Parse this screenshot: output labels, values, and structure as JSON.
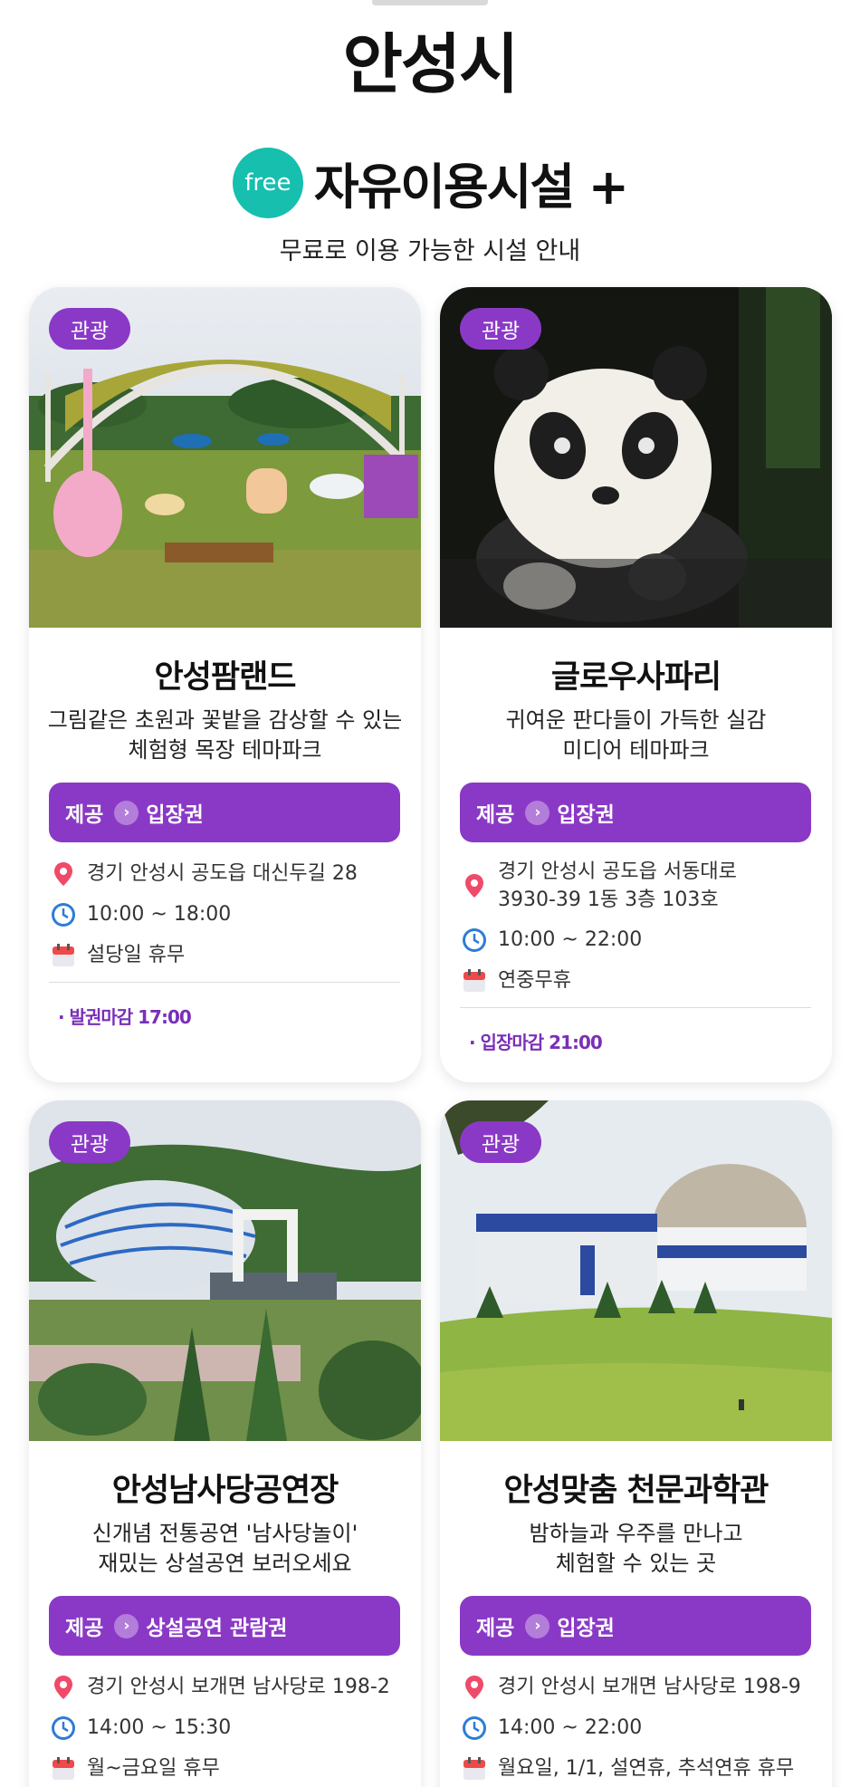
{
  "page": {
    "city": "안성시",
    "free_badge": "free",
    "section_title": "자유이용시설 +",
    "section_subtitle": "무료로 이용 가능한 시설 안내"
  },
  "colors": {
    "accent": "#8a39c6",
    "free": "#16bfae",
    "note": "#7a2fb8"
  },
  "cards": [
    {
      "tag": "관광",
      "title": "안성팜랜드",
      "desc1": "그림같은 초원과 꽃밭을 감상할 수 있는",
      "desc2": "체험형 목장 테마파크",
      "provide_label": "제공",
      "provide_value": "입장권",
      "address": "경기 안성시 공도읍 대신두길 28",
      "hours": "10:00 ~ 18:00",
      "closed": "설당일 휴무",
      "note": "· 발권마감 17:00",
      "image": "farmland-violin-sculpture-photo"
    },
    {
      "tag": "관광",
      "title": "글로우사파리",
      "desc1": "귀여운 판다들이 가득한 실감",
      "desc2": "미디어 테마파크",
      "provide_label": "제공",
      "provide_value": "입장권",
      "address1": "경기 안성시 공도읍 서동대로",
      "address2": "3930-39 1동 3층 103호",
      "hours": "10:00 ~ 22:00",
      "closed": "연중무휴",
      "note": "· 입장마감 21:00",
      "image": "panda-lantern-photo"
    },
    {
      "tag": "관광",
      "title": "안성남사당공연장",
      "desc1": "신개념 전통공연 '남사당놀이'",
      "desc2": "재밌는 상설공연 보러오세요",
      "provide_label": "제공",
      "provide_value": "상설공연 관람권",
      "address": "경기 안성시 보개면 남사당로 198-2",
      "hours": "14:00 ~ 15:30",
      "closed": "월~금요일 휴무",
      "image": "performance-hall-dome-photo"
    },
    {
      "tag": "관광",
      "title": "안성맞춤 천문과학관",
      "desc1": "밤하늘과 우주를 만나고",
      "desc2": "체험할 수 있는 곳",
      "provide_label": "제공",
      "provide_value": "입장권",
      "address": "경기 안성시 보개면 남사당로 198-9",
      "hours": "14:00 ~ 22:00",
      "closed": "월요일, 1/1, 설연휴, 추석연휴 휴무",
      "image": "observatory-dome-photo"
    }
  ],
  "icons": {
    "location": "pin-icon",
    "time": "clock-icon",
    "holiday": "calendar-icon",
    "provide": "chevron-right-icon"
  }
}
